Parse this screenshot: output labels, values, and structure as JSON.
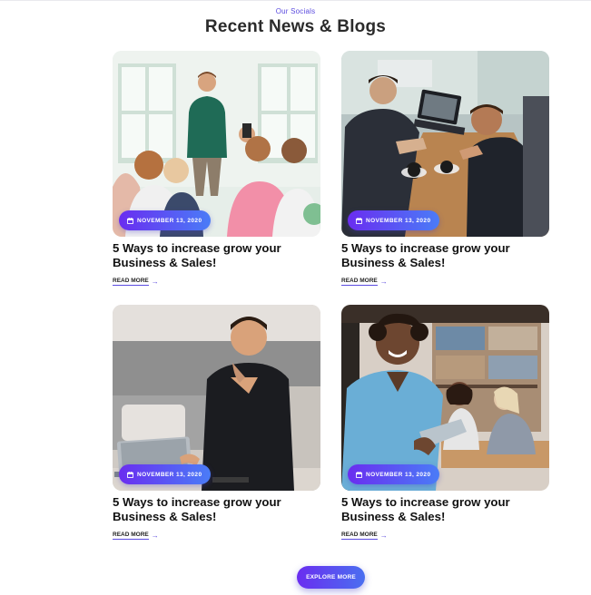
{
  "section": {
    "eyebrow": "Our Socials",
    "title": "Recent News & Blogs"
  },
  "posts": [
    {
      "image_alt": "presenter-addressing-audience",
      "date": "NOVEMBER 13, 2020",
      "title": "5 Ways to increase grow your Business & Sales!",
      "read_more": "READ MORE"
    },
    {
      "image_alt": "team-meeting-with-laptop",
      "date": "NOVEMBER 13, 2020",
      "title": "5 Ways to increase grow your Business & Sales!",
      "read_more": "READ MORE"
    },
    {
      "image_alt": "smiling-man-at-laptop",
      "date": "NOVEMBER 13, 2020",
      "title": "5 Ways to increase grow your Business & Sales!",
      "read_more": "READ MORE"
    },
    {
      "image_alt": "smiling-man-in-office",
      "date": "NOVEMBER 13, 2020",
      "title": "5 Ways to increase grow your Business & Sales!",
      "read_more": "READ MORE"
    }
  ],
  "explore_button": "EXPLORE MORE",
  "colors": {
    "accent": "#5b4bdf",
    "gradient_start": "#6a2df0",
    "gradient_end": "#4a7cf7"
  },
  "icons": {
    "date": "calendar-icon",
    "read_more": "arrow-right-icon"
  }
}
